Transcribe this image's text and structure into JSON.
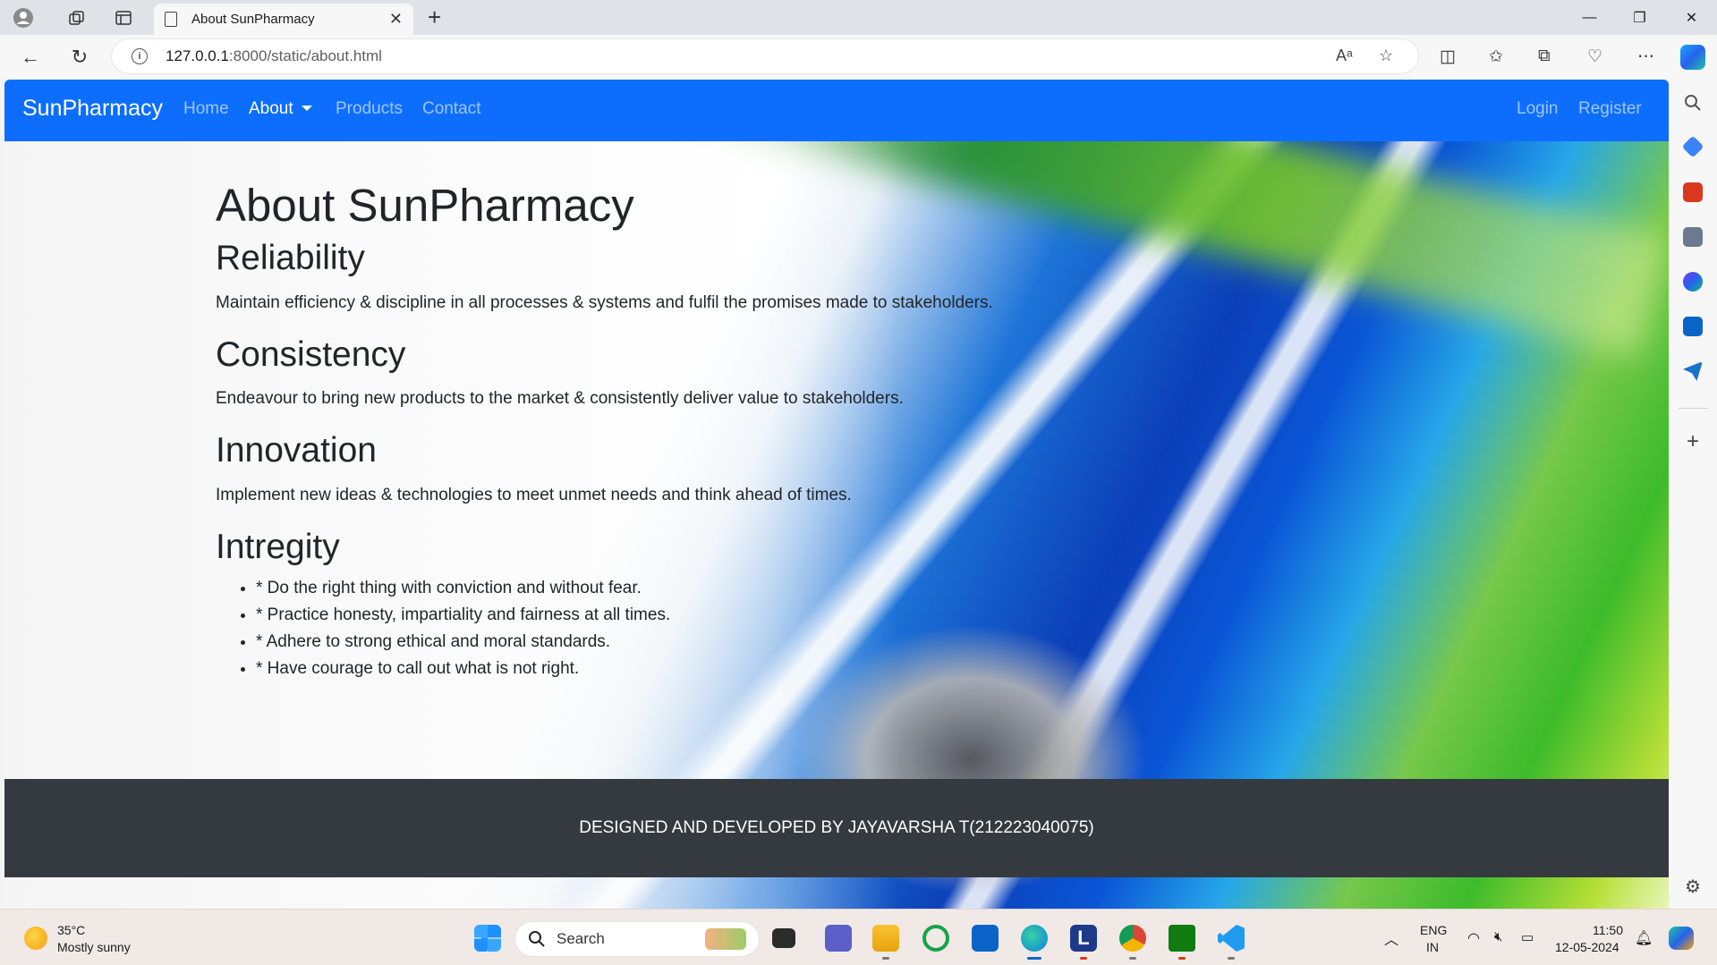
{
  "browser": {
    "tab_title": "About SunPharmacy",
    "url_host": "127.0.0.1",
    "url_path": ":8000/static/about.html"
  },
  "navbar": {
    "brand": "SunPharmacy",
    "links": [
      "Home",
      "About",
      "Products",
      "Contact"
    ],
    "right_links": [
      "Login",
      "Register"
    ]
  },
  "page": {
    "title": "About SunPharmacy",
    "sections": [
      {
        "heading": "Reliability",
        "text": "Maintain efficiency & discipline in all processes & systems and fulfil the promises made to stakeholders."
      },
      {
        "heading": "Consistency",
        "text": "Endeavour to bring new products to the market & consistently deliver value to stakeholders."
      },
      {
        "heading": "Innovation",
        "text": "Implement new ideas & technologies to meet unmet needs and think ahead of times."
      },
      {
        "heading": "Intregity",
        "items": [
          "* Do the right thing with conviction and without fear.",
          "* Practice honesty, impartiality and fairness at all times.",
          "* Adhere to strong ethical and moral standards.",
          "* Have courage to call out what is not right."
        ]
      }
    ]
  },
  "footer": {
    "text": "DESIGNED AND DEVELOPED BY JAYAVARSHA T(212223040075)"
  },
  "taskbar": {
    "temperature": "35°C",
    "weather": "Mostly sunny",
    "search_placeholder": "Search",
    "lang_top": "ENG",
    "lang_bottom": "IN",
    "time": "11:50",
    "date": "12-05-2024"
  },
  "colors": {
    "navbar": "#0d6efd",
    "footer": "#343a40"
  }
}
